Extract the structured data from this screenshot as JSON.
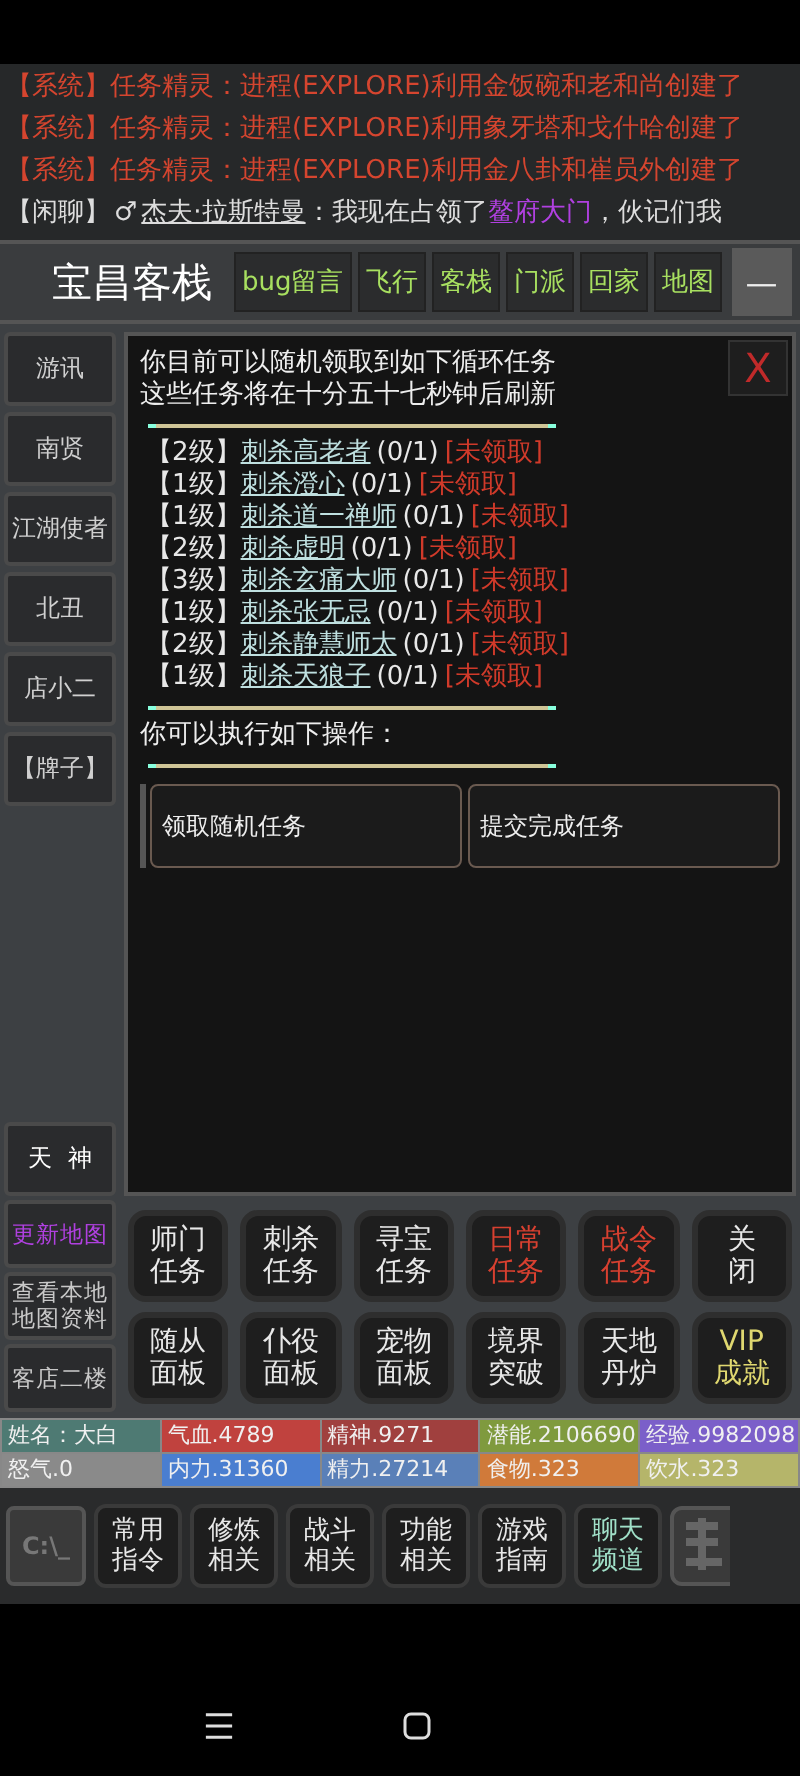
{
  "chat": [
    {
      "kind": "system",
      "text": "【系统】任务精灵：进程(EXPLORE)利用金饭碗和老和尚创建了"
    },
    {
      "kind": "system",
      "text": "【系统】任务精灵：进程(EXPLORE)利用象牙塔和戈什哈创建了"
    },
    {
      "kind": "system",
      "text": "【系统】任务精灵：进程(EXPLORE)利用金八卦和崔员外创建了"
    },
    {
      "kind": "chat",
      "channel": "【闲聊】",
      "gender": "♂",
      "speaker": "杰夫·拉斯特曼",
      "colon": "：",
      "before": "我现在占领了",
      "place": "鳌府大门",
      "after": "，伙记们我"
    }
  ],
  "header": {
    "title": "宝昌客栈",
    "buttons": [
      "bug留言",
      "飞行",
      "客栈",
      "门派",
      "回家",
      "地图"
    ],
    "minimize": "—"
  },
  "npcs": [
    "游讯",
    "南贤",
    "江湖使者",
    "北丑",
    "店小二",
    "【牌子】"
  ],
  "special_npc": "天  神",
  "dialog": {
    "close": "X",
    "intro": [
      "你目前可以随机领取到如下循环任务",
      "这些任务将在十分五十七秒钟后刷新"
    ],
    "tasks": [
      {
        "level": "【2级】",
        "name": "刺杀高老者",
        "progress": "(0/1)",
        "status": "[未领取]"
      },
      {
        "level": "【1级】",
        "name": "刺杀澄心",
        "progress": "(0/1)",
        "status": "[未领取]"
      },
      {
        "level": "【1级】",
        "name": "刺杀道一禅师",
        "progress": "(0/1)",
        "status": "[未领取]"
      },
      {
        "level": "【2级】",
        "name": "刺杀虚明",
        "progress": "(0/1)",
        "status": "[未领取]"
      },
      {
        "level": "【3级】",
        "name": "刺杀玄痛大师",
        "progress": "(0/1)",
        "status": "[未领取]"
      },
      {
        "level": "【1级】",
        "name": "刺杀张无忌",
        "progress": "(0/1)",
        "status": "[未领取]"
      },
      {
        "level": "【2级】",
        "name": "刺杀静慧师太",
        "progress": "(0/1)",
        "status": "[未领取]"
      },
      {
        "level": "【1级】",
        "name": "刺杀天狼子",
        "progress": "(0/1)",
        "status": "[未领取]"
      }
    ],
    "prompt": "你可以执行如下操作：",
    "actions": [
      "领取随机任务",
      "提交完成任务"
    ]
  },
  "map_links": [
    {
      "label": "更新地图",
      "color": "#b040e0"
    },
    {
      "label": "查看本地地图资料",
      "color": "#c8c8c8"
    },
    {
      "label": "客店二楼",
      "color": "#c8c8c8"
    }
  ],
  "menu": [
    {
      "lines": [
        "师门",
        "任务"
      ],
      "color": "#e8e8e8"
    },
    {
      "lines": [
        "刺杀",
        "任务"
      ],
      "color": "#e8e8e8"
    },
    {
      "lines": [
        "寻宝",
        "任务"
      ],
      "color": "#e8e8e8"
    },
    {
      "lines": [
        "日常",
        "任务"
      ],
      "color": "#d84030"
    },
    {
      "lines": [
        "战令",
        "任务"
      ],
      "color": "#d84030"
    },
    {
      "lines": [
        "关",
        "闭"
      ],
      "color": "#e8e8e8"
    },
    {
      "lines": [
        "随从",
        "面板"
      ],
      "color": "#e8e8e8"
    },
    {
      "lines": [
        "仆役",
        "面板"
      ],
      "color": "#e8e8e8"
    },
    {
      "lines": [
        "宠物",
        "面板"
      ],
      "color": "#e8e8e8"
    },
    {
      "lines": [
        "境界",
        "突破"
      ],
      "color": "#e8e8e8"
    },
    {
      "lines": [
        "天地",
        "丹炉"
      ],
      "color": "#e8e8e8"
    },
    {
      "lines": [
        "VIP",
        "成就"
      ],
      "color": "#e0d870"
    }
  ],
  "stats": [
    {
      "label": "姓名：大白",
      "color": "#4e7a73"
    },
    {
      "label": "气血.4789",
      "color": "#c0423e"
    },
    {
      "label": "精神.9271",
      "color": "#a0403e"
    },
    {
      "label": "潜能.2106690",
      "color": "#7f9a3e"
    },
    {
      "label": "经验.9982098",
      "color": "#7b5fc9"
    },
    {
      "label": "怒气.0",
      "color": "#8a8a8a"
    },
    {
      "label": "内力.31360",
      "color": "#4a7ed0"
    },
    {
      "label": "精力.27214",
      "color": "#5a80b8"
    },
    {
      "label": "食物.323",
      "color": "#d07a3a"
    },
    {
      "label": "饮水.323",
      "color": "#b5b56a"
    }
  ],
  "toolbar": {
    "terminal": "C:\\_",
    "buttons": [
      {
        "lines": [
          "常用",
          "指令"
        ],
        "color": "#e8e8e8"
      },
      {
        "lines": [
          "修炼",
          "相关"
        ],
        "color": "#e8e8e8"
      },
      {
        "lines": [
          "战斗",
          "相关"
        ],
        "color": "#e8e8e8"
      },
      {
        "lines": [
          "功能",
          "相关"
        ],
        "color": "#e8e8e8"
      },
      {
        "lines": [
          "游戏",
          "指南"
        ],
        "color": "#e8e8e8"
      },
      {
        "lines": [
          "聊天",
          "频道"
        ],
        "color": "#a0e0c8"
      }
    ]
  }
}
